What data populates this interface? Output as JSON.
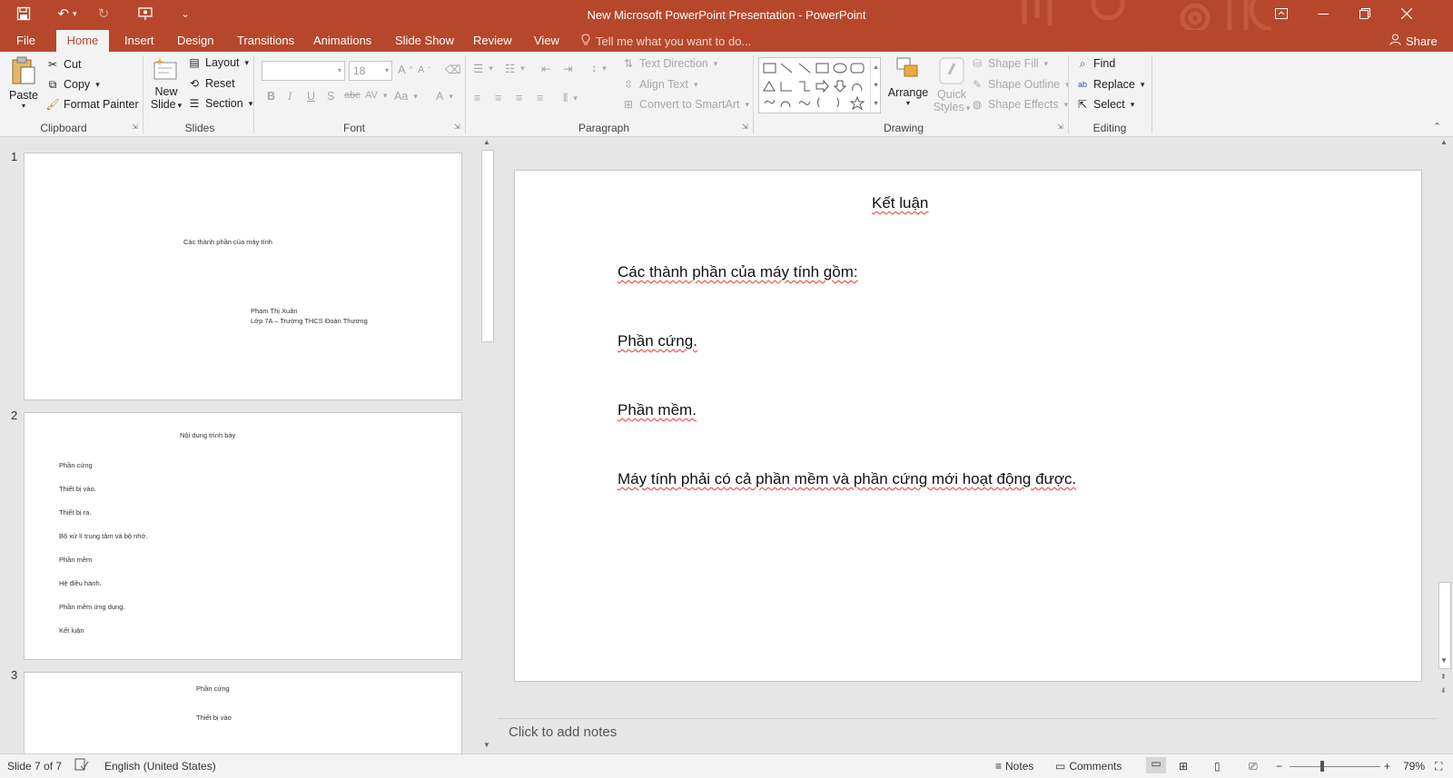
{
  "window": {
    "title": "New Microsoft PowerPoint Presentation - PowerPoint",
    "share_label": "Share"
  },
  "tabs": [
    {
      "label": "File"
    },
    {
      "label": "Home"
    },
    {
      "label": "Insert"
    },
    {
      "label": "Design"
    },
    {
      "label": "Transitions"
    },
    {
      "label": "Animations"
    },
    {
      "label": "Slide Show"
    },
    {
      "label": "Review"
    },
    {
      "label": "View"
    }
  ],
  "tell_me": {
    "placeholder": "Tell me what you want to do..."
  },
  "ribbon": {
    "clipboard": {
      "label": "Clipboard",
      "paste": "Paste",
      "cut": "Cut",
      "copy": "Copy",
      "format_painter": "Format Painter"
    },
    "slides": {
      "label": "Slides",
      "new_slide_1": "New",
      "new_slide_2": "Slide",
      "layout": "Layout",
      "reset": "Reset",
      "section": "Section"
    },
    "font": {
      "label": "Font",
      "size": "18"
    },
    "paragraph": {
      "label": "Paragraph",
      "text_direction": "Text Direction",
      "align_text": "Align Text",
      "convert_smartart": "Convert to SmartArt"
    },
    "drawing": {
      "label": "Drawing",
      "arrange": "Arrange",
      "quick_styles_1": "Quick",
      "quick_styles_2": "Styles",
      "shape_fill": "Shape Fill",
      "shape_outline": "Shape Outline",
      "shape_effects": "Shape Effects"
    },
    "editing": {
      "label": "Editing",
      "find": "Find",
      "replace": "Replace",
      "select": "Select"
    }
  },
  "thumbnails": [
    {
      "number": "1",
      "title": "Các thành phần của máy tính",
      "author": "Phạm Thị Xuân",
      "class": "Lớp 7A – Trường THCS Đoàn Thương"
    },
    {
      "number": "2",
      "title": "Nội dung trình bày",
      "items": [
        "Phần cứng",
        "Thiết bị vào.",
        "Thiết bị ra.",
        "Bộ xử lí trung tâm và bộ nhớ.",
        "Phần mềm",
        "Hệ điều hành.",
        "Phần mềm ứng dụng.",
        "Kết luận"
      ]
    },
    {
      "number": "3",
      "title": "Phần cứng",
      "subtitle": "Thiết bị vào"
    }
  ],
  "current_slide": {
    "title": "Kết luận",
    "lines": [
      "Các thành phần của máy tính gồm:",
      "Phần cứng.",
      "Phần mềm.",
      "Máy tính phải có cả phần mềm và phần cứng mới hoạt động được."
    ]
  },
  "notes": {
    "placeholder": "Click to add notes"
  },
  "status": {
    "slide_info": "Slide 7 of 7",
    "language": "English (United States)",
    "notes_label": "Notes",
    "comments_label": "Comments",
    "zoom": "79%"
  },
  "colors": {
    "accent": "#b7472a",
    "ribbon_bg": "#f3f3f3",
    "canvas_bg": "#e6e6e6",
    "spell_underline": "#e33333"
  }
}
